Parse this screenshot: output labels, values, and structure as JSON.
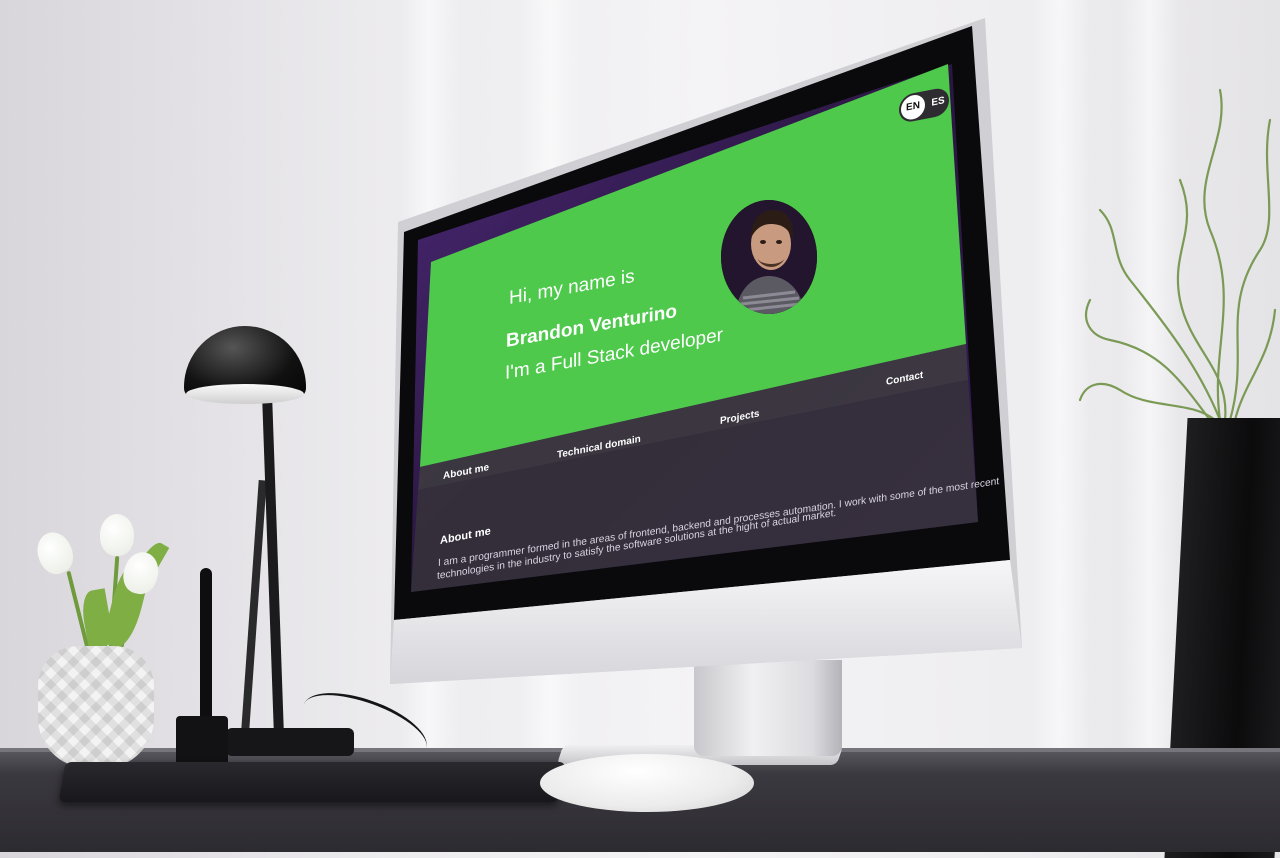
{
  "language_toggle": {
    "en": "EN",
    "es": "ES"
  },
  "hero": {
    "line1": "Hi, my name is",
    "name": "Brandon Venturino",
    "line3": "I'm a Full Stack developer"
  },
  "nav": {
    "items": [
      {
        "label": "About me"
      },
      {
        "label": "Technical domain"
      },
      {
        "label": "Projects"
      },
      {
        "label": "Contact"
      }
    ]
  },
  "about": {
    "title": "About me",
    "text_line1": "I am a programmer formed in the areas of frontend, backend and processes automation. I work with some of the most recent",
    "text_line2": "technologies in the industry to satisfy the software solutions at the hight of actual market."
  },
  "colors": {
    "hero_green": "#4ec94c",
    "nav_bar": "#3d3a40",
    "about_bg": "#36323a",
    "screen_purple": "#3a1d5c"
  },
  "icons": {
    "language": "globe-toggle",
    "avatar": "profile-photo"
  }
}
